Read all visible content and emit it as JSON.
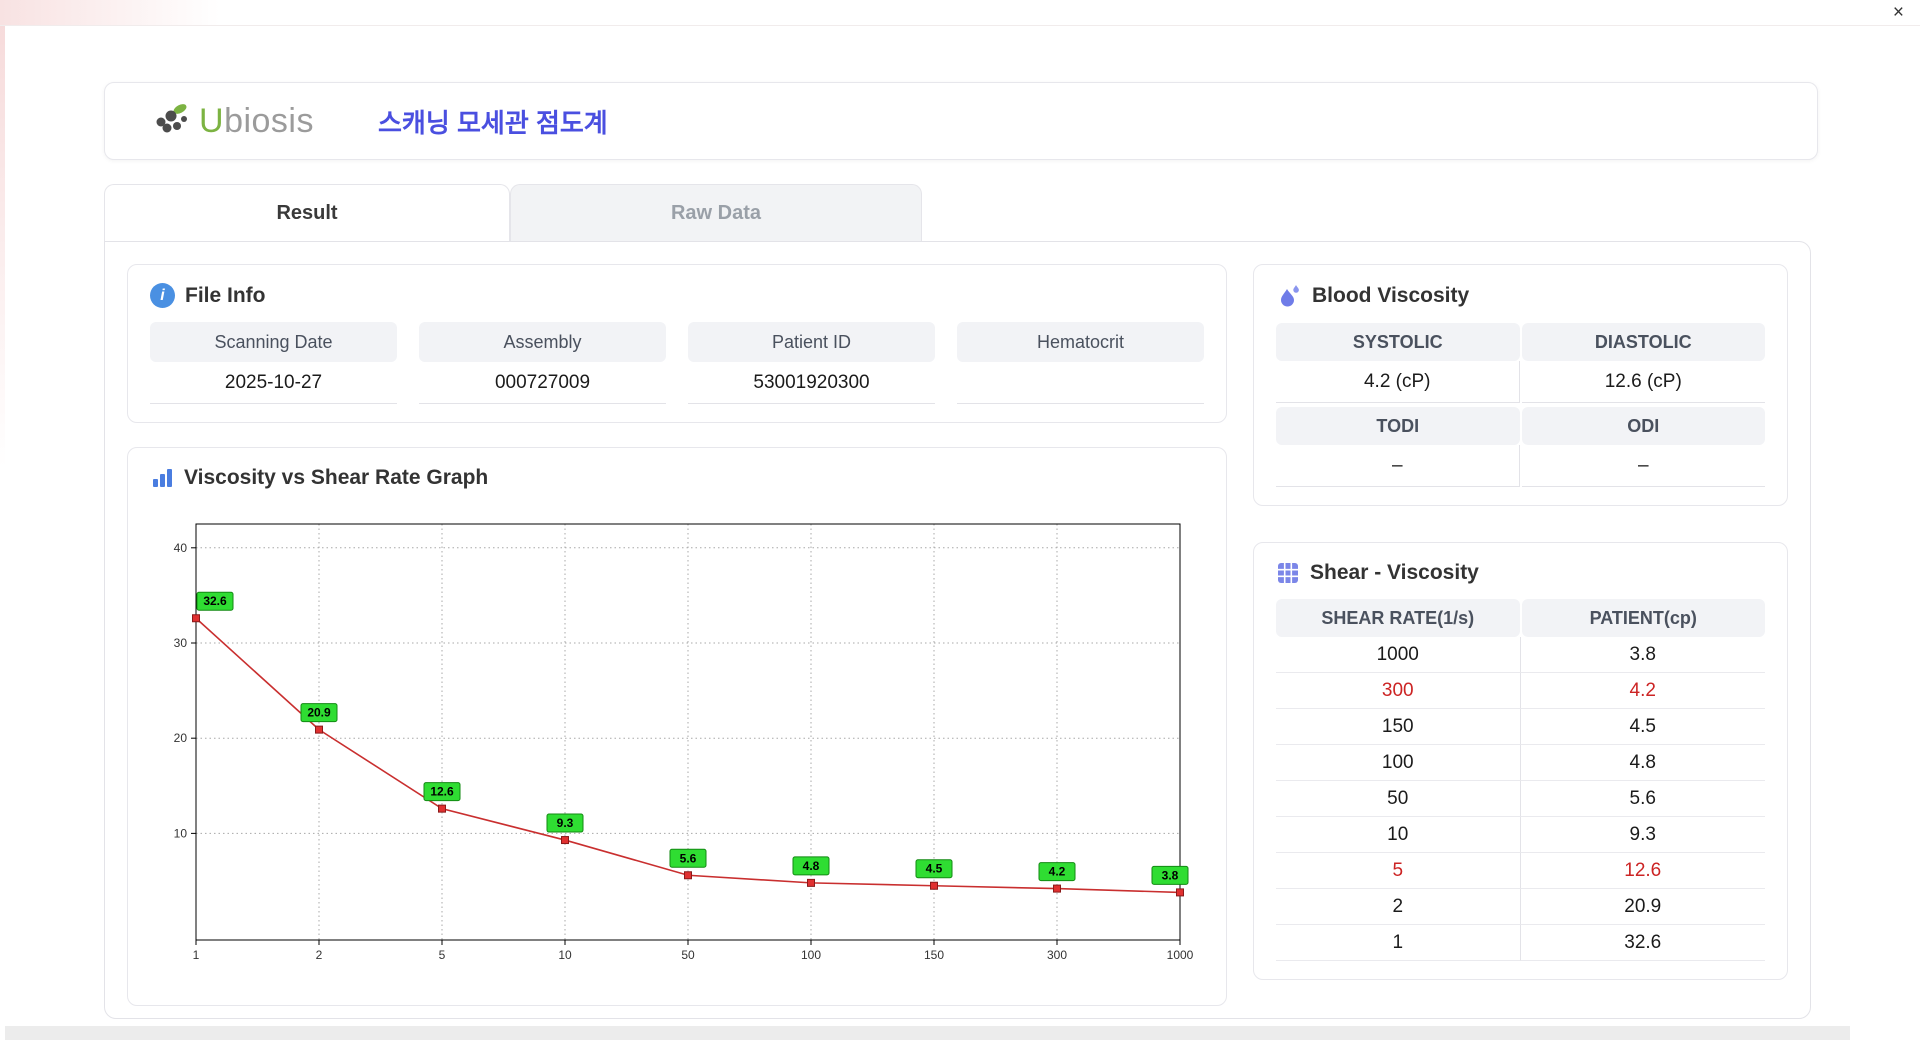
{
  "window": {
    "close_label": "×"
  },
  "header": {
    "brand_u": "U",
    "brand_rest": "biosis",
    "title": "스캐닝 모세관 점도계"
  },
  "tabs": [
    {
      "label": "Result",
      "active": true
    },
    {
      "label": "Raw Data",
      "active": false
    }
  ],
  "file_info": {
    "title": "File Info",
    "fields": [
      {
        "label": "Scanning Date",
        "value": "2025-10-27"
      },
      {
        "label": "Assembly",
        "value": "000727009"
      },
      {
        "label": "Patient ID",
        "value": "53001920300"
      },
      {
        "label": "Hematocrit",
        "value": ""
      }
    ]
  },
  "graph": {
    "title": "Viscosity vs Shear Rate Graph"
  },
  "chart_data": {
    "type": "line",
    "title": "Viscosity vs Shear Rate Graph",
    "categories": [
      "1",
      "2",
      "5",
      "10",
      "50",
      "100",
      "150",
      "300",
      "1000"
    ],
    "values": [
      32.6,
      20.9,
      12.6,
      9.3,
      5.6,
      4.8,
      4.5,
      4.2,
      3.8
    ],
    "xlabel": "",
    "ylabel": "",
    "yticks": [
      10,
      20,
      30,
      40
    ],
    "ylim": [
      -1.2,
      42.5
    ],
    "grid": "dotted",
    "line_color": "#c92f2f",
    "marker_color": "#e03030",
    "label_bg": "#2fdd32",
    "label_border": "#128a12"
  },
  "blood_viscosity": {
    "title": "Blood Viscosity",
    "rows": [
      {
        "h1": "SYSTOLIC",
        "h2": "DIASTOLIC",
        "v1": "4.2 (cP)",
        "v2": "12.6 (cP)"
      },
      {
        "h1": "TODI",
        "h2": "ODI",
        "v1": "–",
        "v2": "–"
      }
    ]
  },
  "shear_table": {
    "title": "Shear - Viscosity",
    "headers": [
      "SHEAR RATE(1/s)",
      "PATIENT(cp)"
    ],
    "rows": [
      {
        "rate": "1000",
        "patient": "3.8",
        "highlight": false
      },
      {
        "rate": "300",
        "patient": "4.2",
        "highlight": true
      },
      {
        "rate": "150",
        "patient": "4.5",
        "highlight": false
      },
      {
        "rate": "100",
        "patient": "4.8",
        "highlight": false
      },
      {
        "rate": "50",
        "patient": "5.6",
        "highlight": false
      },
      {
        "rate": "10",
        "patient": "9.3",
        "highlight": false
      },
      {
        "rate": "5",
        "patient": "12.6",
        "highlight": true
      },
      {
        "rate": "2",
        "patient": "20.9",
        "highlight": false
      },
      {
        "rate": "1",
        "patient": "32.6",
        "highlight": false
      }
    ]
  },
  "colors": {
    "accent_blue": "#4a4fe0",
    "brand_green": "#7cb342",
    "highlight_red": "#cc2424",
    "header_gray": "#f2f3f6"
  }
}
